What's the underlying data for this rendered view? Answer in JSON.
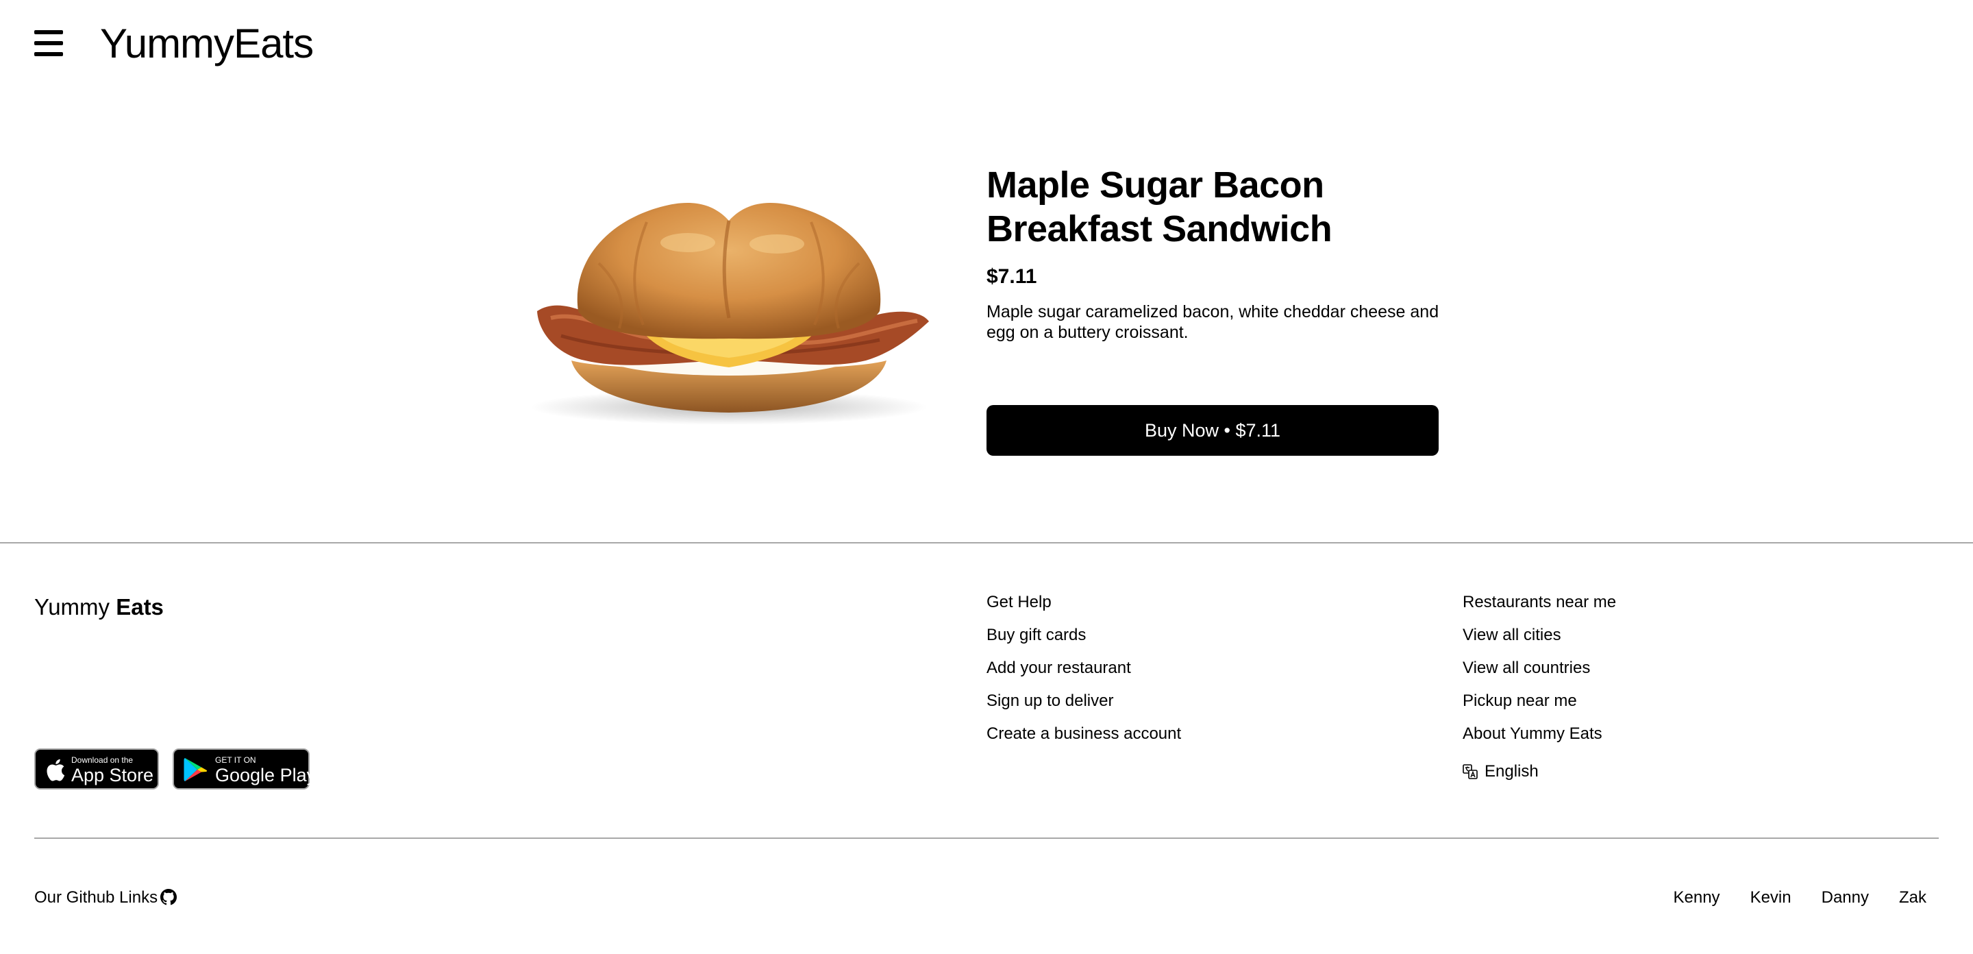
{
  "header": {
    "brand_part1": "Yummy",
    "brand_part2": "Eats"
  },
  "product": {
    "title": "Maple Sugar Bacon Breakfast Sandwich",
    "price": "$7.11",
    "description": "Maple sugar caramelized bacon, white cheddar cheese and egg on a buttery croissant.",
    "buy_button_label": "Buy Now • $7.11",
    "image_alt": "Maple Sugar Bacon Breakfast Sandwich"
  },
  "footer": {
    "brand_part1": "Yummy ",
    "brand_part2": "Eats",
    "col1": [
      "Get Help",
      "Buy gift cards",
      "Add your restaurant",
      "Sign up to deliver",
      "Create a business account"
    ],
    "col2": [
      "Restaurants near me",
      "View all cities",
      "View all countries",
      "Pickup near me",
      "About Yummy Eats"
    ],
    "language": "English",
    "app_store": {
      "small": "Download on the",
      "big": "App Store"
    },
    "google_play": {
      "small": "GET IT ON",
      "big": "Google Play"
    },
    "github_label": "Our Github Links",
    "github_links": [
      "Kenny",
      "Kevin",
      "Danny",
      "Zak"
    ]
  },
  "icons": {
    "menu": "hamburger-menu-icon",
    "apple": "apple-icon",
    "google_play": "google-play-icon",
    "language": "translate-icon",
    "github": "github-icon"
  },
  "colors": {
    "primary": "#000000",
    "background": "#ffffff",
    "divider": "#a8a8a8"
  }
}
